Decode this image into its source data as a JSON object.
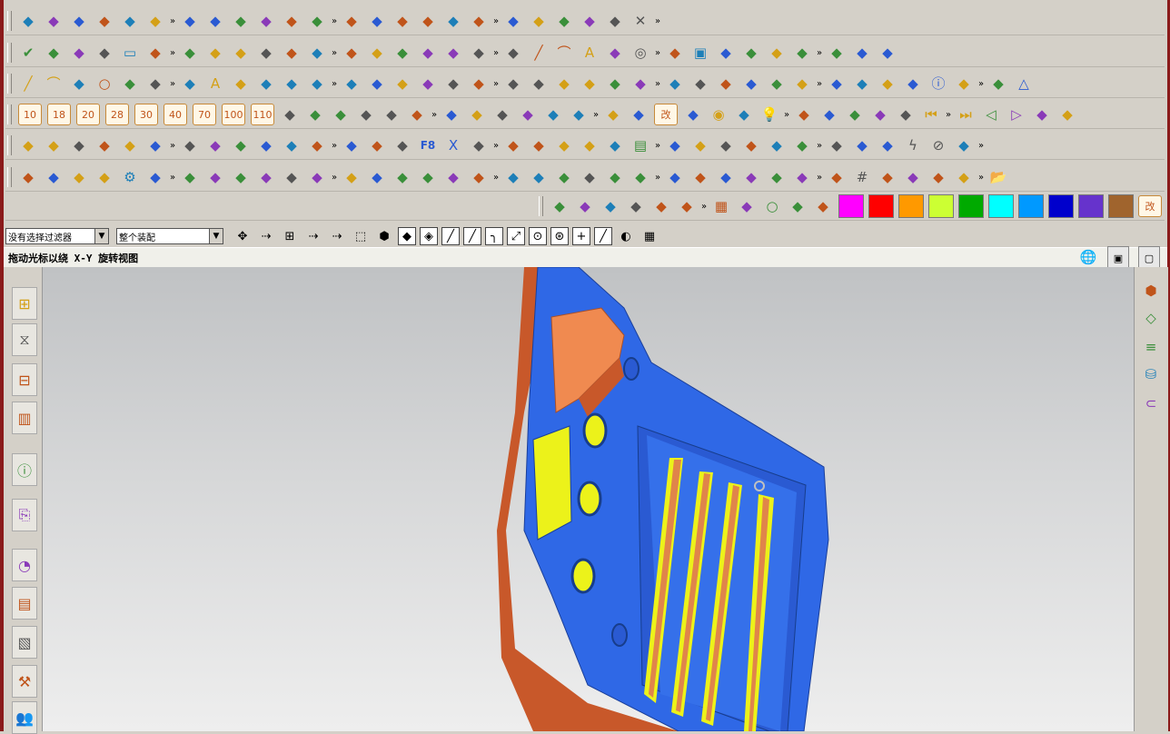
{
  "colors": {
    "frame": "#8a1a1a",
    "toolbar_bg": "#d4d0c8",
    "part_blue": "#2f68e6",
    "part_orange": "#c8582a",
    "part_yellow": "#ecf21a",
    "part_salmon": "#f08a50"
  },
  "toolbar_rows": [
    {
      "icons": [
        "assembly-icon",
        "layer-icon",
        "part-nav-icon",
        "eraser-icon",
        "move-icon",
        "hammer-icon",
        "copy-icon",
        "abc-icon",
        "wave-icon",
        "link-icon",
        "sketch-icon",
        "cylinder-icon",
        "pipe-icon",
        "coin-icon",
        "no-icon",
        "cube-add-icon",
        "cube-a-icon",
        "cube-b-icon",
        "cube-c-icon",
        "cube-d-icon",
        "cube-e-icon",
        "cube-f-icon",
        "cube-g-icon",
        "cross-icon"
      ]
    },
    {
      "icons": [
        "check-icon",
        "tree-icon",
        "grid-icon",
        "axis-icon",
        "rect-icon",
        "book-icon",
        "shield-icon",
        "half-icon",
        "pen-icon",
        "stair-icon",
        "puzzle-icon",
        "node-icon",
        "flat-icon",
        "wedge-icon",
        "plate-icon",
        "crate-icon",
        "vase-icon",
        "bolt-icon",
        "box-icon",
        "line-icon",
        "arc-icon",
        "text-icon",
        "curve-icon",
        "globe-icon",
        "hammer-icon",
        "cube-icon",
        "stack-icon",
        "ladder-icon",
        "rail-icon",
        "gate-icon",
        "bar-icon",
        "measure-icon",
        "wrench-icon"
      ]
    },
    {
      "icons": [
        "line-icon",
        "arc-icon",
        "spline-icon",
        "circle-icon",
        "s-icon",
        "s2-icon",
        "s3-icon",
        "text-icon",
        "pin-icon",
        "pencil-icon",
        "merge-icon",
        "bend-icon",
        "tag-icon",
        "flag-icon",
        "slab-icon",
        "slab2-icon",
        "sheet-icon",
        "sheet2-icon",
        "cup-icon",
        "cylinders-icon",
        "hatch-icon",
        "iron-icon",
        "seat-icon",
        "wave-icon",
        "drape-icon",
        "net-icon",
        "mesh-icon",
        "bowl-icon",
        "brush-icon",
        "grid-green-icon",
        "grid-red-icon",
        "frame-icon",
        "diamond-icon",
        "shade-icon",
        "info-icon",
        "cone-icon",
        "ball-icon",
        "triangle-icon"
      ]
    },
    {
      "numbers": [
        "10",
        "18",
        "20",
        "28",
        "30",
        "40",
        "70",
        "100",
        "110"
      ],
      "icons": [
        "bracket-icon",
        "beam-icon",
        "tee-icon",
        "base-icon",
        "lid-icon",
        "arch-icon",
        "dome-icon",
        "hook-icon",
        "corner-icon",
        "flag-icon",
        "seven-icon",
        "post-icon",
        "bridge-icon",
        "step-icon",
        "mod-icon",
        "eye-icon",
        "person-icon",
        "bulb-icon",
        "bulb2-icon",
        "bulbs-icon",
        "bulbs2-icon",
        "bulbs3-icon",
        "bulbs4-icon",
        "nav-first-icon",
        "nav-last-icon",
        "nav-prev-icon",
        "nav-next-icon",
        "pattern-icon",
        "tool-icon"
      ]
    },
    {
      "icons": [
        "char-icon",
        "dim-icon",
        "box3d-icon",
        "cube3d-icon",
        "palette-icon",
        "broom-icon",
        "red-cube-icon",
        "square-icon",
        "form-icon",
        "corner3d-icon",
        "shape-icon",
        "shelf-icon",
        "panel-icon",
        "cross-hair-icon",
        "axis-xy-icon",
        "f8-icon",
        "x-icon",
        "gold-blocks-icon",
        "gold-blocks2-icon",
        "wand-icon",
        "sweep-icon",
        "trim-icon",
        "curve-s-icon",
        "doc-icon",
        "curve-j-icon",
        "curve-w-icon",
        "wave-blue-icon",
        "wave-blue2-icon",
        "eye-blue-icon",
        "diamond-red-icon",
        "spray-icon",
        "feather-icon",
        "brush2-icon",
        "lightning-icon",
        "no-entry-icon",
        "pin-gold-icon"
      ]
    },
    {
      "icons": [
        "grid-blue-icon",
        "grid-move-icon",
        "bracket-l-icon",
        "y-icon",
        "gear-icon",
        "tower-icon",
        "tower2-icon",
        "pillar-icon",
        "tee2-icon",
        "circle-plus-icon",
        "green-block-icon",
        "pi-icon",
        "spring-icon",
        "door-icon",
        "door2-icon",
        "bar2-icon",
        "bar3-icon",
        "frame2-icon",
        "fork-icon",
        "key-icon",
        "t-beam-icon",
        "corner2-icon",
        "lamp-icon",
        "box-orange-icon",
        "square2-icon",
        "table-icon",
        "hook2-icon",
        "l-shape-icon",
        "rect2-icon",
        "rect3-icon",
        "stripes-icon",
        "hash-icon",
        "pipe2-icon",
        "bracket2-icon",
        "tab-icon",
        "tab2-icon",
        "folder-icon"
      ]
    },
    {
      "icons": [
        "clamp-icon",
        "joint-icon",
        "socket-icon",
        "plug-icon",
        "elbow-icon",
        "cup2-icon",
        "calculator-icon",
        "i-beam-icon",
        "ring-icon",
        "half-round-icon",
        "pieces-icon"
      ],
      "color_swatches": [
        "#ff00ff",
        "#ff0000",
        "#ff9900",
        "#ccff33",
        "#00aa00",
        "#00ffff",
        "#0099ff",
        "#0000cc",
        "#6633cc",
        "#a0642d"
      ],
      "mod_label": "改"
    },
    {
      "num_labels": [
        "10",
        "18",
        "20",
        "28",
        "30",
        "40",
        "70",
        "100",
        "110"
      ]
    }
  ],
  "toolbar_row4_mod": "改",
  "row5_f8": "F8",
  "selection_bar": {
    "filter_value": "没有选择过滤器",
    "scope_value": "整个装配"
  },
  "cue_line": "拖动光标以绕 X-Y 旋转视图",
  "left_resource_icons": [
    "assembly-navigator-icon",
    "constraint-navigator-icon",
    "part-navigator-icon",
    "reuse-library-icon",
    "web-info-icon",
    "document-icon",
    "history-icon",
    "system-materials-icon",
    "visualization-icon",
    "process-studio-icon",
    "roles-icon"
  ],
  "right_resource_icons": [
    "view-cube-icon",
    "shaded-view-icon",
    "layer-list-icon",
    "parts-icon",
    "pipe-view-icon"
  ]
}
